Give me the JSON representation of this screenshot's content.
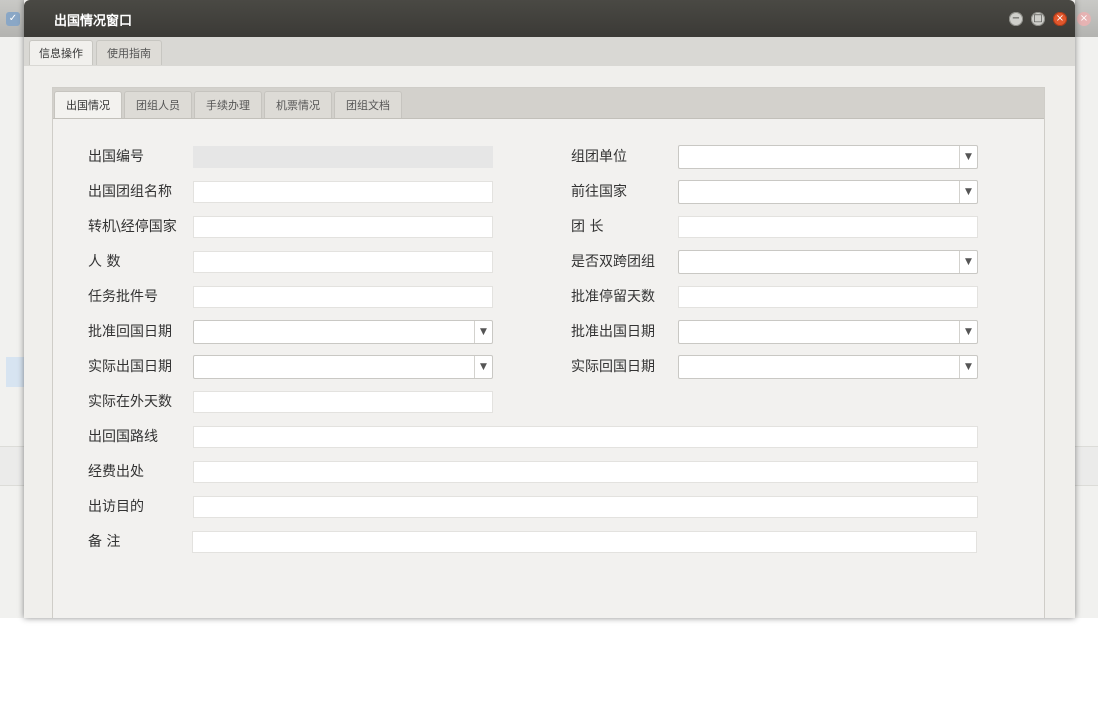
{
  "modal": {
    "title": "出国情况窗口",
    "top_tabs": [
      "信息操作",
      "使用指南"
    ],
    "sub_tabs": [
      "出国情况",
      "团组人员",
      "手续办理",
      "机票情况",
      "团组文档"
    ]
  },
  "form": {
    "fields": [
      {
        "id": "exit_no",
        "label": "出国编号",
        "type": "readonly",
        "value": ""
      },
      {
        "id": "group_unit",
        "label": "组团单位",
        "type": "select",
        "value": ""
      },
      {
        "id": "group_name",
        "label": "出国团组名称",
        "type": "text",
        "value": ""
      },
      {
        "id": "dest_country",
        "label": "前往国家",
        "type": "select",
        "value": ""
      },
      {
        "id": "transit_country",
        "label": "转机\\经停国家",
        "type": "text",
        "value": ""
      },
      {
        "id": "leader",
        "label": "团 长",
        "type": "text",
        "value": ""
      },
      {
        "id": "headcount",
        "label": "人 数",
        "type": "text",
        "value": ""
      },
      {
        "id": "dual_cross",
        "label": "是否双跨团组",
        "type": "select",
        "value": ""
      },
      {
        "id": "task_approval",
        "label": "任务批件号",
        "type": "text",
        "value": ""
      },
      {
        "id": "approved_stay_days",
        "label": "批准停留天数",
        "type": "text",
        "value": ""
      },
      {
        "id": "approved_return_date",
        "label": "批准回国日期",
        "type": "select",
        "value": ""
      },
      {
        "id": "approved_exit_date",
        "label": "批准出国日期",
        "type": "select",
        "value": ""
      },
      {
        "id": "actual_exit_date",
        "label": "实际出国日期",
        "type": "select",
        "value": ""
      },
      {
        "id": "actual_return_date",
        "label": "实际回国日期",
        "type": "select",
        "value": ""
      },
      {
        "id": "actual_days_abroad",
        "label": "实际在外天数",
        "type": "text",
        "value": ""
      },
      {
        "id": "route",
        "label": "出回国路线",
        "type": "text",
        "value": ""
      },
      {
        "id": "funding_source",
        "label": "经费出处",
        "type": "text",
        "value": ""
      },
      {
        "id": "visit_purpose",
        "label": "出访目的",
        "type": "text",
        "value": ""
      },
      {
        "id": "remarks",
        "label": "备 注",
        "type": "text",
        "value": ""
      }
    ]
  },
  "icons": {
    "minimize": "minimize-icon",
    "maximize": "maximize-icon",
    "close": "close-icon",
    "dropdown": "chevron-down-icon"
  },
  "colors": {
    "titlebar": "#3b3a36",
    "close_button": "#e2572c"
  }
}
